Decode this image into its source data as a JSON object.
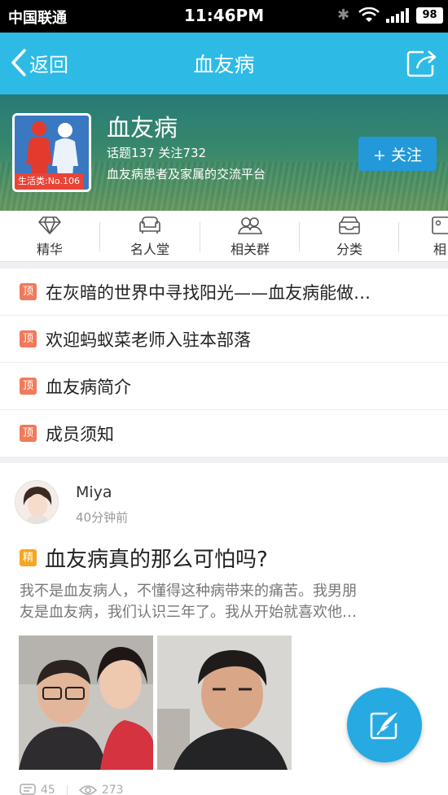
{
  "status_bar": {
    "carrier": "中国联通",
    "time": "11:46PM",
    "battery": "98"
  },
  "nav": {
    "back_label": "返回",
    "title": "血友病"
  },
  "group": {
    "name": "血友病",
    "category_tag": "生活类:No.106",
    "stats": "话题137  关注732",
    "description": "血友病患者及家属的交流平台",
    "follow_label": "+ 关注"
  },
  "tabs": [
    {
      "label": "精华",
      "icon": "diamond-icon"
    },
    {
      "label": "名人堂",
      "icon": "sofa-icon"
    },
    {
      "label": "相关群",
      "icon": "group-icon"
    },
    {
      "label": "分类",
      "icon": "inbox-icon"
    },
    {
      "label": "相",
      "icon": "photo-icon"
    }
  ],
  "pinned": {
    "badge": "顶",
    "items": [
      "在灰暗的世界中寻找阳光——血友病能做…",
      "欢迎蚂蚁菜老师入驻本部落",
      "血友病简介",
      "成员须知"
    ]
  },
  "post": {
    "author": "Miya",
    "time": "40分钟前",
    "badge": "精",
    "title": "血友病真的那么可怕吗?",
    "excerpt_line1": "我不是血友病人，不懂得这种病带来的痛苦。我男朋",
    "excerpt_line2": "友是血友病，我们认识三年了。我从开始就喜欢他…",
    "comments": "45",
    "views": "273"
  },
  "colors": {
    "nav_bg": "#2dbbe6",
    "follow_btn": "#2399da",
    "pin_badge": "#f17a5a",
    "essence_badge": "#f5a623",
    "fab": "#27a9e1"
  }
}
